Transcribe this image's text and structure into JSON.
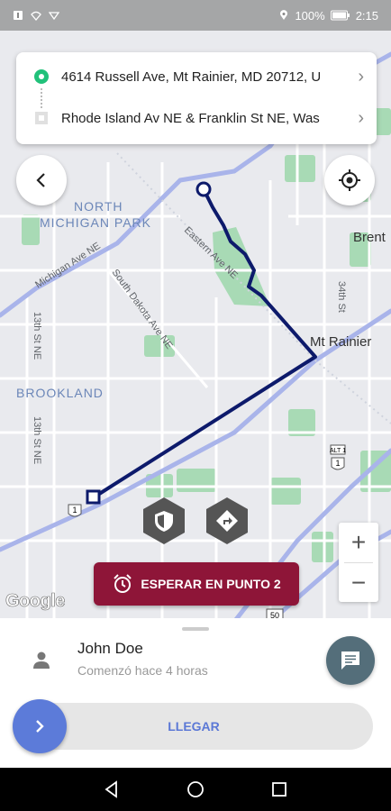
{
  "status_bar": {
    "battery_percent": "100%",
    "time": "2:15",
    "icons": [
      "notification-icon",
      "wifi-icon",
      "signal-icon",
      "location-icon",
      "battery-icon"
    ]
  },
  "route": {
    "origin": "4614 Russell Ave, Mt Rainier, MD 20712, U",
    "destination": "Rhode Island Av NE & Franklin St NE, Was"
  },
  "map": {
    "labels": {
      "north_michigan_park": "NORTH MICHIGAN PARK",
      "brookland": "BROOKLAND",
      "mt_rainier": "Mt Rainier",
      "brent": "Brent",
      "eastern_ave": "Eastern Ave NE",
      "michigan_ave": "Michigan Ave NE",
      "south_dakota": "South Dakota Ave NE",
      "st13_a": "13th St NE",
      "st13_b": "13th St NE",
      "st34": "34th St",
      "shield_1a": "1",
      "shield_1b": "1",
      "shield_alt": "ALT 1",
      "shield_50": "50"
    },
    "google": "Google",
    "route_color": "#0d1a6b",
    "park_color": "#a8dab5"
  },
  "controls": {
    "wait_button": "ESPERAR EN PUNTO 2",
    "zoom_in": "+",
    "zoom_out": "−"
  },
  "sheet": {
    "user_name": "John Doe",
    "user_status": "Comenzó hace 4 horas",
    "arrive_label": "LLEGAR"
  },
  "colors": {
    "accent_blue": "#5c7bd9",
    "wait_red": "#8e1538",
    "origin_green": "#21c17a"
  }
}
